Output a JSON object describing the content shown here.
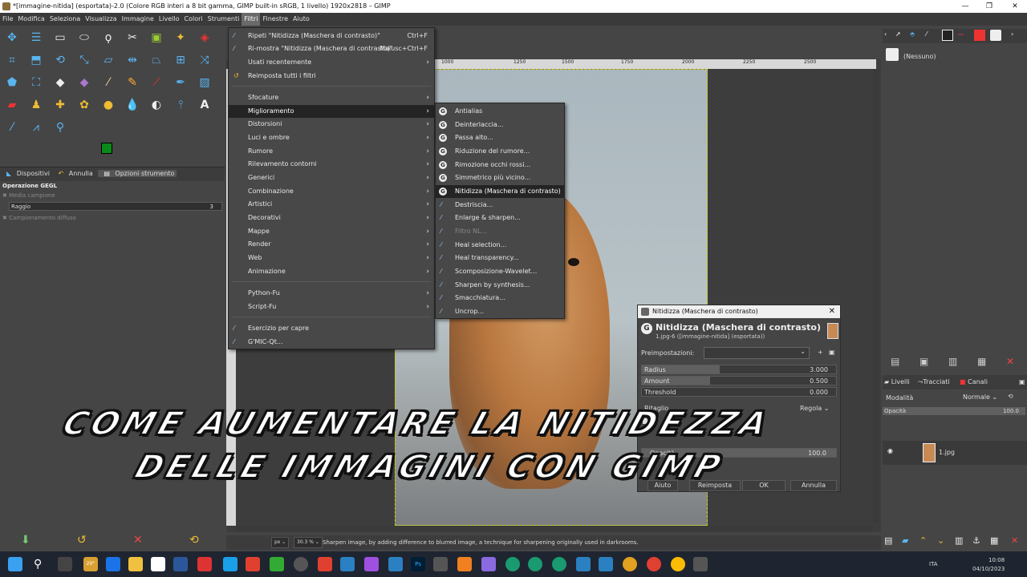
{
  "window": {
    "title": "*[immagine-nitida] (esportata)-2.0 (Colore RGB interi a 8 bit gamma, GIMP built-in sRGB, 1 livello) 1920x2818 – GIMP"
  },
  "menubar": [
    "File",
    "Modifica",
    "Seleziona",
    "Visualizza",
    "Immagine",
    "Livello",
    "Colori",
    "Strumenti",
    "Filtri",
    "Finestre",
    "Aiuto"
  ],
  "filters_menu": {
    "repeat": {
      "label": "Ripeti \"Nitidizza (Maschera di contrasto)\"",
      "shortcut": "Ctrl+F"
    },
    "reshow": {
      "label": "Ri-mostra \"Nitidizza (Maschera di contrasto)\"",
      "shortcut": "Maiusc+Ctrl+F"
    },
    "recent": "Usati recentemente",
    "reset": "Reimposta tutti i filtri",
    "categories": [
      "Sfocature",
      "Miglioramento",
      "Distorsioni",
      "Luci e ombre",
      "Rumore",
      "Rilevamento contorni",
      "Generici",
      "Combinazione",
      "Artistici",
      "Decorativi",
      "Mappe",
      "Render",
      "Web",
      "Animazione"
    ],
    "scripts": [
      "Python-Fu",
      "Script-Fu"
    ],
    "extras": [
      "Esercizio per capre",
      "G'MIC-Qt..."
    ]
  },
  "enhance_submenu": [
    "Antialias",
    "Deinterlaccia...",
    "Passa alto...",
    "Riduzione del rumore...",
    "Rimozione occhi rossi...",
    "Simmetrico più vicino...",
    "Nitidizza (Maschera di contrasto)",
    "Destriscia...",
    "Enlarge & sharpen...",
    "Filtro NL...",
    "Heal selection...",
    "Heal transparency...",
    "Scomposizione-Wavelet...",
    "Sharpen by synthesis...",
    "Smacchiatura...",
    "Uncrop..."
  ],
  "toolbox": {
    "tabs": [
      "Dispositivi",
      "Annulla",
      "Opzioni strumento"
    ],
    "operation": "Operazione GEGL",
    "sample_average": "Media campione",
    "radius_label": "Raggio",
    "radius_value": "3",
    "diffuse": "Campionamento diffuso",
    "fg_color": "#0b8a1a",
    "bg_color": "#ffffff"
  },
  "dialog": {
    "title": "Nitidizza (Maschera di contrasto)",
    "heading": "Nitidizza (Maschera di contrasto)",
    "subtitle": "1.jpg-6 ([immagine-nitida] (esportata))",
    "presets_label": "Preimpostazioni:",
    "params": [
      {
        "name": "Radius",
        "value": "3.000",
        "fill": 0.4
      },
      {
        "name": "Amount",
        "value": "0.500",
        "fill": 0.35
      },
      {
        "name": "Threshold",
        "value": "0.000",
        "fill": 0.0
      }
    ],
    "clip_label": "Ritaglio",
    "clip_value": "Regola",
    "opacity_label": "Opacità",
    "opacity_value": "100.0",
    "buttons": [
      "Aiuto",
      "Reimposta",
      "OK",
      "Annulla"
    ]
  },
  "right_dock": {
    "brush_none": "(Nessuno)",
    "tabs": [
      "Livelli",
      "Tracciati",
      "Canali"
    ],
    "mode_label": "Modalità",
    "mode_value": "Normale",
    "opacity_label": "Opacità",
    "opacity_value": "100.0",
    "layer_name": "1.jpg"
  },
  "statusbar": {
    "unit": "px",
    "zoom": "30.3 %",
    "message": "Sharpen image, by adding difference to blurred image, a technique for sharpening originally used in darkrooms."
  },
  "overlay": {
    "line1": "COME AUMENTARE LA NITIDEZZA",
    "line2": "DELLE IMMAGINI CON GIMP"
  },
  "ruler_ticks": [
    "1000",
    "1250",
    "1500",
    "1750",
    "2000",
    "2250",
    "2500"
  ],
  "taskbar": {
    "lang": "ITA",
    "time": "10:08",
    "date": "04/10/2023",
    "weather": "20°"
  }
}
